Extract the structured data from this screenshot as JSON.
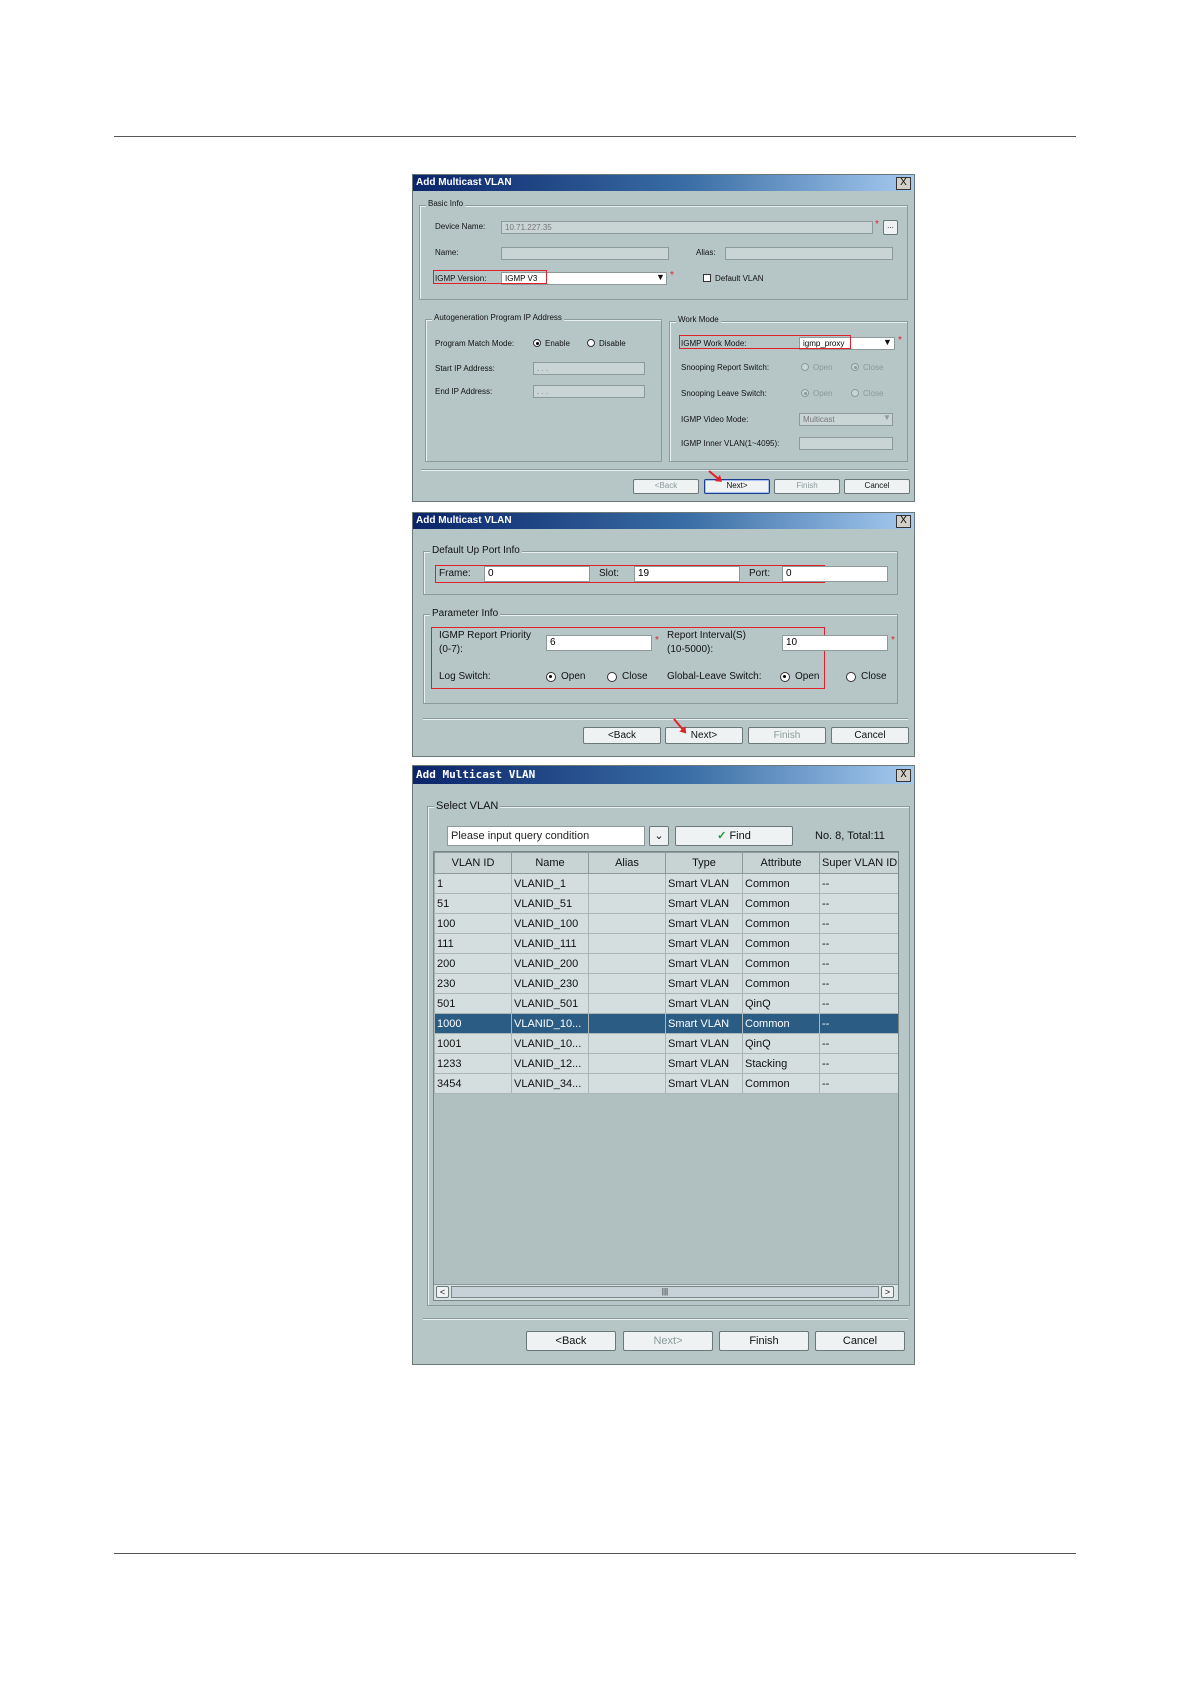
{
  "dialog1": {
    "title": "Add Multicast VLAN",
    "close": "X",
    "basic_info": {
      "group_title": "Basic Info",
      "device_name_label": "Device Name:",
      "device_name_value": "10.71.227.35",
      "browse": "...",
      "name_label": "Name:",
      "alias_label": "Alias:",
      "igmp_version_label": "IGMP Version:",
      "igmp_version_value": "IGMP V3",
      "default_vlan_label": "Default VLAN"
    },
    "autogen": {
      "group_title": "Autogeneration Program IP Address",
      "match_mode_label": "Program Match Mode:",
      "enable": "Enable",
      "disable": "Disable",
      "start_ip_label": "Start IP Address:",
      "end_ip_label": "End IP Address:",
      "ip_placeholder": ". . ."
    },
    "work_mode": {
      "group_title": "Work Mode",
      "igmp_work_mode_label": "IGMP Work Mode:",
      "igmp_work_mode_value": "igmp_proxy",
      "snooping_report_label": "Snooping Report Switch:",
      "snooping_leave_label": "Snooping Leave Switch:",
      "open": "Open",
      "close": "Close",
      "video_mode_label": "IGMP Video Mode:",
      "video_mode_value": "Multicast",
      "inner_vlan_label": "IGMP Inner VLAN(1~4095):"
    },
    "buttons": {
      "back": "<Back",
      "next": "Next>",
      "finish": "Finish",
      "cancel": "Cancel"
    }
  },
  "dialog2": {
    "title": "Add Multicast VLAN",
    "close": "X",
    "up_port": {
      "group_title": "Default Up Port Info",
      "frame_label": "Frame:",
      "frame_value": "0",
      "slot_label": "Slot:",
      "slot_value": "19",
      "port_label": "Port:",
      "port_value": "0"
    },
    "params": {
      "group_title": "Parameter Info",
      "priority_label_1": "IGMP Report Priority",
      "priority_label_2": "(0-7):",
      "priority_value": "6",
      "interval_label_1": "Report Interval(S)",
      "interval_label_2": "(10-5000):",
      "interval_value": "10",
      "log_switch_label": "Log Switch:",
      "global_leave_label": "Global-Leave Switch:",
      "open": "Open",
      "close": "Close"
    },
    "buttons": {
      "back": "<Back",
      "next": "Next>",
      "finish": "Finish",
      "cancel": "Cancel"
    }
  },
  "dialog3": {
    "title": "Add Multicast VLAN",
    "close": "X",
    "group_title": "Select VLAN",
    "query_placeholder": "Please input query condition",
    "find": "Find",
    "count": "No. 8, Total:11",
    "columns": [
      "VLAN ID",
      "Name",
      "Alias",
      "Type",
      "Attribute",
      "Super VLAN ID"
    ],
    "rows": [
      [
        "1",
        "VLANID_1",
        "",
        "Smart VLAN",
        "Common",
        "--"
      ],
      [
        "51",
        "VLANID_51",
        "",
        "Smart VLAN",
        "Common",
        "--"
      ],
      [
        "100",
        "VLANID_100",
        "",
        "Smart VLAN",
        "Common",
        "--"
      ],
      [
        "111",
        "VLANID_111",
        "",
        "Smart VLAN",
        "Common",
        "--"
      ],
      [
        "200",
        "VLANID_200",
        "",
        "Smart VLAN",
        "Common",
        "--"
      ],
      [
        "230",
        "VLANID_230",
        "",
        "Smart VLAN",
        "Common",
        "--"
      ],
      [
        "501",
        "VLANID_501",
        "",
        "Smart VLAN",
        "QinQ",
        "--"
      ],
      [
        "1000",
        "VLANID_10...",
        "",
        "Smart VLAN",
        "Common",
        "--"
      ],
      [
        "1001",
        "VLANID_10...",
        "",
        "Smart VLAN",
        "QinQ",
        "--"
      ],
      [
        "1233",
        "VLANID_12...",
        "",
        "Smart VLAN",
        "Stacking",
        "--"
      ],
      [
        "3454",
        "VLANID_34...",
        "",
        "Smart VLAN",
        "Common",
        "--"
      ]
    ],
    "selected_index": 7,
    "buttons": {
      "back": "<Back",
      "next": "Next>",
      "finish": "Finish",
      "cancel": "Cancel"
    }
  },
  "colors": {
    "dialog_bg": "#b6c6c6",
    "title_start": "#0a246a",
    "highlight_red": "#e0202a",
    "selected_row": "#2b5d84"
  }
}
